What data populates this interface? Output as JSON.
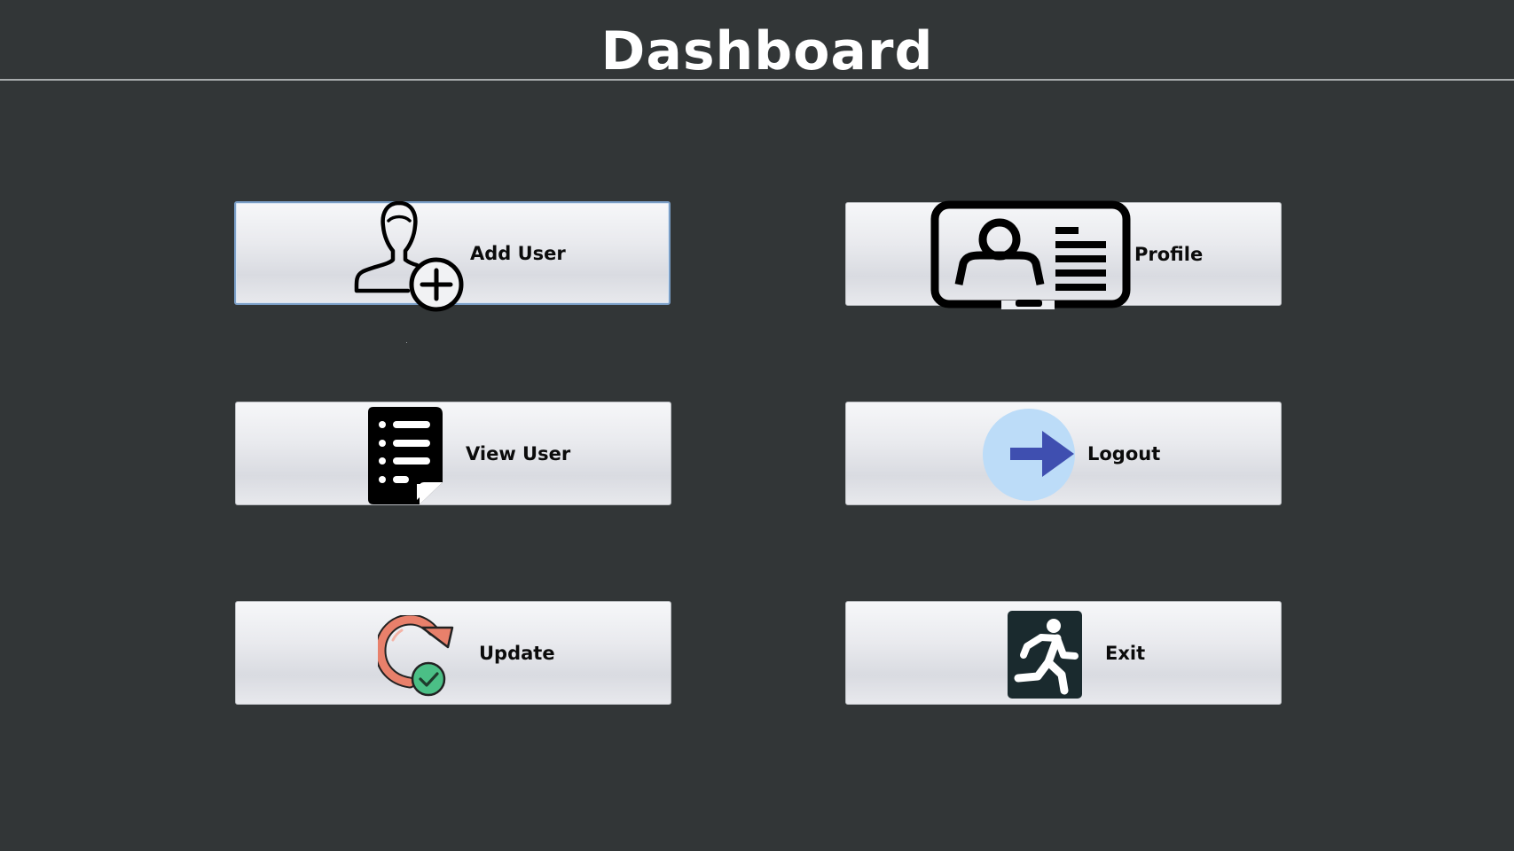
{
  "window": {
    "title": "Dashboard"
  },
  "buttons": {
    "add_user": {
      "label": "Add User",
      "icon": "add-user-icon"
    },
    "profile": {
      "label": "Profile",
      "icon": "id-card-icon"
    },
    "view_user": {
      "label": "View User",
      "icon": "list-document-icon"
    },
    "logout": {
      "label": "Logout",
      "icon": "arrow-right-icon"
    },
    "update": {
      "label": "Update",
      "icon": "refresh-check-icon"
    },
    "exit": {
      "label": "Exit",
      "icon": "running-exit-icon"
    }
  },
  "colors": {
    "background": "#323637",
    "title_text": "#ffffff",
    "divider": "#a8acad",
    "focus_border": "#7a9ec6",
    "logout_circle": "#bcdcf8",
    "logout_arrow": "#3f4fb0",
    "update_arrow": "#e8806b",
    "update_check": "#4bbf86",
    "exit_sign": "#1a2a2e"
  }
}
